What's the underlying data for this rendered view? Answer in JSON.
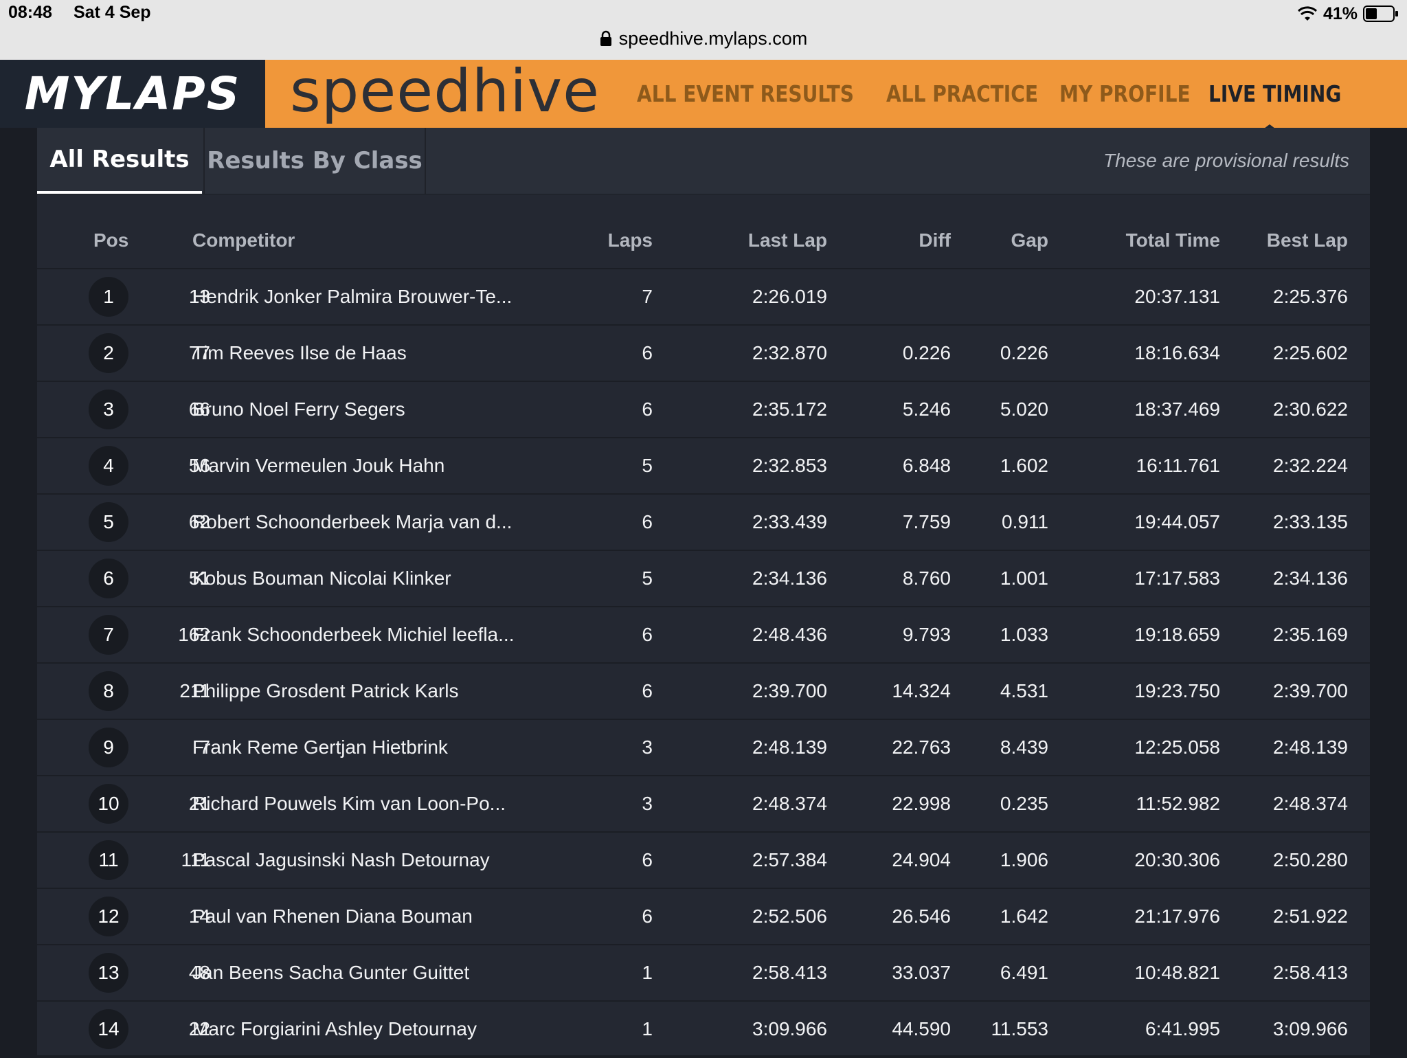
{
  "status_bar": {
    "time": "08:48",
    "date": "Sat 4 Sep",
    "battery": "41%"
  },
  "browser": {
    "url": "speedhive.mylaps.com"
  },
  "header": {
    "brand_left": "MYLAPS",
    "brand_right": "speedhive",
    "nav": [
      {
        "label": "ALL EVENT RESULTS"
      },
      {
        "label": "ALL PRACTICE"
      },
      {
        "label": "MY PROFILE"
      },
      {
        "label": "LIVE TIMING"
      }
    ],
    "active_nav": "LIVE TIMING",
    "colors": {
      "orange": "#f0973a",
      "dark": "#1e2530"
    }
  },
  "tabs": {
    "all_results": "All Results",
    "results_by_class": "Results By Class",
    "provisional_note": "These are provisional results"
  },
  "table": {
    "headers": {
      "pos": "Pos",
      "competitor": "Competitor",
      "laps": "Laps",
      "last_lap": "Last Lap",
      "diff": "Diff",
      "gap": "Gap",
      "total_time": "Total Time",
      "best_lap": "Best Lap"
    },
    "rows": [
      {
        "pos": "1",
        "num": "13",
        "competitor": "Hendrik Jonker Palmira Brouwer-Te...",
        "laps": "7",
        "last_lap": "2:26.019",
        "diff": "",
        "gap": "",
        "total": "20:37.131",
        "best": "2:25.376"
      },
      {
        "pos": "2",
        "num": "77",
        "competitor": "Tim Reeves Ilse de Haas",
        "laps": "6",
        "last_lap": "2:32.870",
        "diff": "0.226",
        "gap": "0.226",
        "total": "18:16.634",
        "best": "2:25.602"
      },
      {
        "pos": "3",
        "num": "66",
        "competitor": "Bruno Noel Ferry Segers",
        "laps": "6",
        "last_lap": "2:35.172",
        "diff": "5.246",
        "gap": "5.020",
        "total": "18:37.469",
        "best": "2:30.622"
      },
      {
        "pos": "4",
        "num": "56",
        "competitor": "Marvin Vermeulen Jouk Hahn",
        "laps": "5",
        "last_lap": "2:32.853",
        "diff": "6.848",
        "gap": "1.602",
        "total": "16:11.761",
        "best": "2:32.224"
      },
      {
        "pos": "5",
        "num": "62",
        "competitor": "Robert Schoonderbeek Marja van d...",
        "laps": "6",
        "last_lap": "2:33.439",
        "diff": "7.759",
        "gap": "0.911",
        "total": "19:44.057",
        "best": "2:33.135"
      },
      {
        "pos": "6",
        "num": "51",
        "competitor": "Kobus Bouman Nicolai Klinker",
        "laps": "5",
        "last_lap": "2:34.136",
        "diff": "8.760",
        "gap": "1.001",
        "total": "17:17.583",
        "best": "2:34.136"
      },
      {
        "pos": "7",
        "num": "162",
        "competitor": "Frank Schoonderbeek Michiel leefla...",
        "laps": "6",
        "last_lap": "2:48.436",
        "diff": "9.793",
        "gap": "1.033",
        "total": "19:18.659",
        "best": "2:35.169"
      },
      {
        "pos": "8",
        "num": "211",
        "competitor": "Philippe Grosdent Patrick Karls",
        "laps": "6",
        "last_lap": "2:39.700",
        "diff": "14.324",
        "gap": "4.531",
        "total": "19:23.750",
        "best": "2:39.700"
      },
      {
        "pos": "9",
        "num": "7",
        "competitor": "Frank Reme Gertjan Hietbrink",
        "laps": "3",
        "last_lap": "2:48.139",
        "diff": "22.763",
        "gap": "8.439",
        "total": "12:25.058",
        "best": "2:48.139"
      },
      {
        "pos": "10",
        "num": "21",
        "competitor": "Richard Pouwels Kim van Loon-Po...",
        "laps": "3",
        "last_lap": "2:48.374",
        "diff": "22.998",
        "gap": "0.235",
        "total": "11:52.982",
        "best": "2:48.374"
      },
      {
        "pos": "11",
        "num": "111",
        "competitor": "Pascal Jagusinski Nash Detournay",
        "laps": "6",
        "last_lap": "2:57.384",
        "diff": "24.904",
        "gap": "1.906",
        "total": "20:30.306",
        "best": "2:50.280"
      },
      {
        "pos": "12",
        "num": "14",
        "competitor": "Paul van Rhenen Diana Bouman",
        "laps": "6",
        "last_lap": "2:52.506",
        "diff": "26.546",
        "gap": "1.642",
        "total": "21:17.976",
        "best": "2:51.922"
      },
      {
        "pos": "13",
        "num": "48",
        "competitor": "Jan Beens Sacha Gunter Guittet",
        "laps": "1",
        "last_lap": "2:58.413",
        "diff": "33.037",
        "gap": "6.491",
        "total": "10:48.821",
        "best": "2:58.413"
      },
      {
        "pos": "14",
        "num": "22",
        "competitor": "Marc Forgiarini Ashley Detournay",
        "laps": "1",
        "last_lap": "3:09.966",
        "diff": "44.590",
        "gap": "11.553",
        "total": "6:41.995",
        "best": "3:09.966"
      }
    ]
  }
}
